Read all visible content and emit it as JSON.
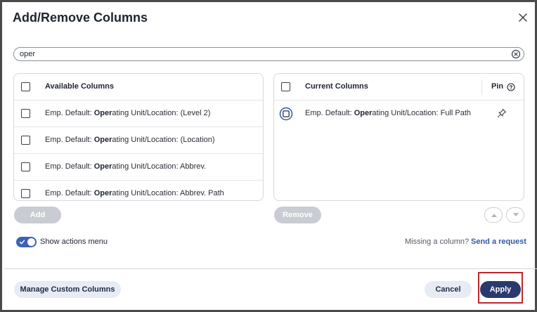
{
  "dialog": {
    "title": "Add/Remove Columns",
    "close_icon": "close-icon"
  },
  "search": {
    "value": "oper",
    "clear_icon": "clear-circle-icon"
  },
  "available": {
    "header": "Available Columns",
    "rows": [
      {
        "prefix": "Emp. Default: ",
        "match": "Oper",
        "suffix": "ating Unit/Location: (Level 2)"
      },
      {
        "prefix": "Emp. Default: ",
        "match": "Oper",
        "suffix": "ating Unit/Location: (Location)"
      },
      {
        "prefix": "Emp. Default: ",
        "match": "Oper",
        "suffix": "ating Unit/Location: Abbrev."
      },
      {
        "prefix": "Emp. Default: ",
        "match": "Oper",
        "suffix": "ating Unit/Location: Abbrev. Path"
      }
    ],
    "add_label": "Add"
  },
  "current": {
    "header": "Current Columns",
    "pin_header": "Pin",
    "rows": [
      {
        "prefix": "Emp. Default: ",
        "match": "Oper",
        "suffix": "ating Unit/Location: Full Path"
      }
    ],
    "remove_label": "Remove"
  },
  "options": {
    "show_actions_label": "Show actions menu",
    "show_actions_on": true,
    "missing_text": "Missing a column?",
    "request_link": "Send a request"
  },
  "footer": {
    "manage_label": "Manage Custom Columns",
    "cancel_label": "Cancel",
    "apply_label": "Apply"
  },
  "colors": {
    "primary": "#2a3a6e",
    "link": "#2f5ba8",
    "toggle": "#3b63b5",
    "highlight": "#c0262d",
    "secondary_bg": "#e6ebf4",
    "disabled": "#c9ccd2"
  }
}
